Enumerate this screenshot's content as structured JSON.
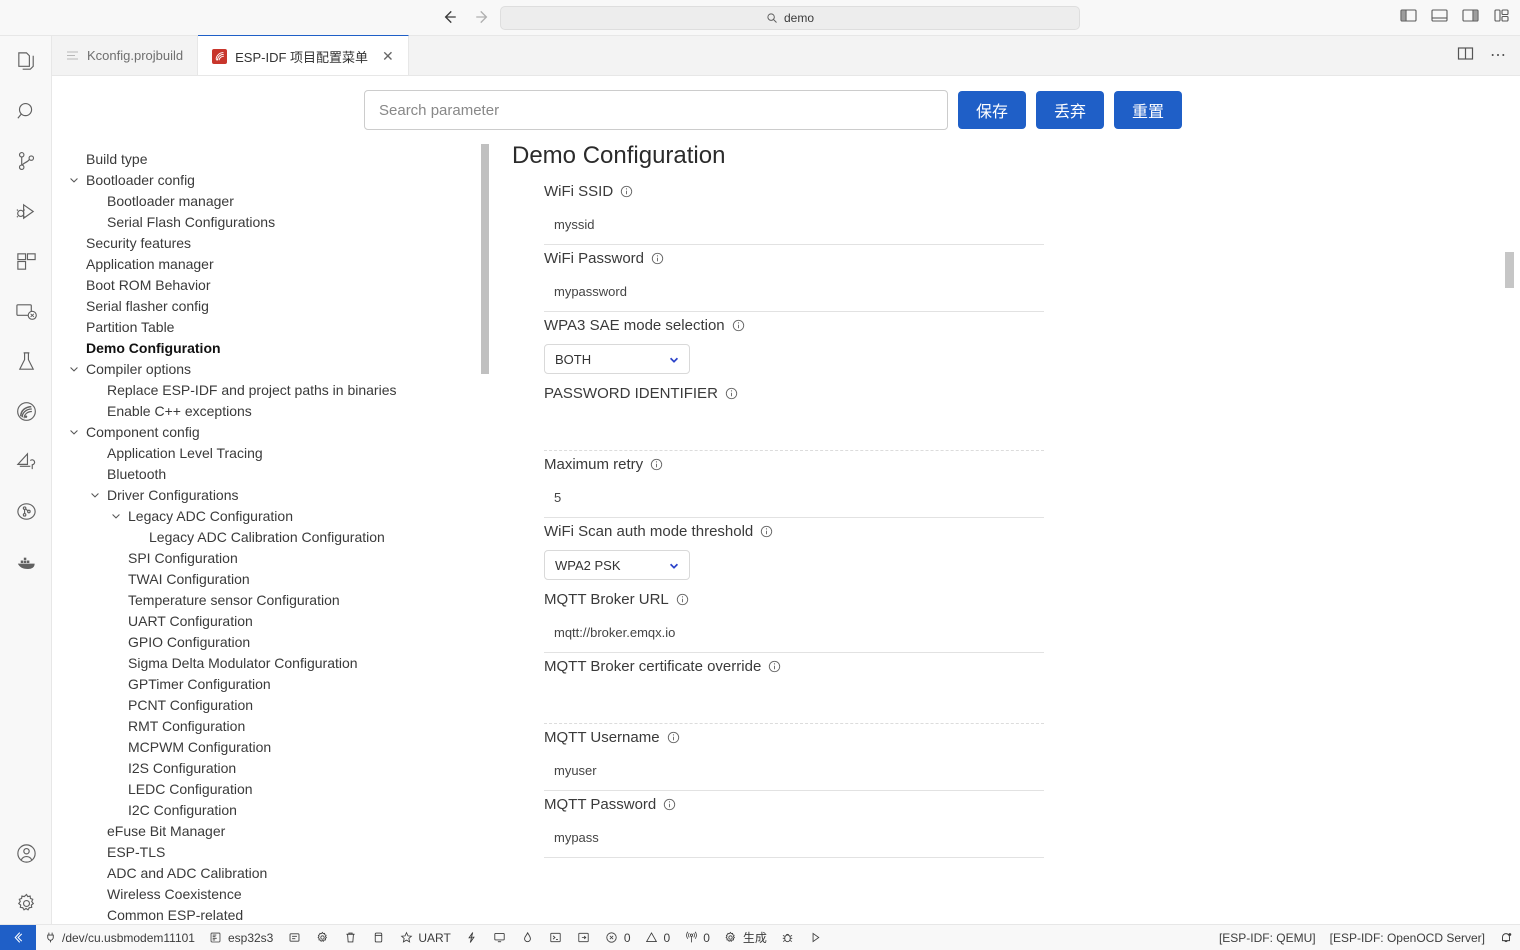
{
  "titlebar": {
    "back_icon": "arrow-left-icon",
    "forward_icon": "arrow-right-icon",
    "search_text": "demo",
    "search_icon": "search-icon",
    "layout_buttons": [
      {
        "name": "toggle-primary-sidebar",
        "icon": "layout-sidebar-left-icon"
      },
      {
        "name": "toggle-panel",
        "icon": "layout-panel-bottom-icon"
      },
      {
        "name": "toggle-secondary-sidebar",
        "icon": "layout-sidebar-right-icon"
      },
      {
        "name": "customize-layout",
        "icon": "layout-grid-icon"
      }
    ]
  },
  "activitybar": {
    "items": [
      {
        "name": "explorer",
        "icon": "files-icon"
      },
      {
        "name": "search",
        "icon": "search-icon"
      },
      {
        "name": "source-control",
        "icon": "source-control-icon"
      },
      {
        "name": "run-and-debug",
        "icon": "run-debug-icon"
      },
      {
        "name": "extensions",
        "icon": "extensions-icon"
      },
      {
        "name": "remote-explorer",
        "icon": "remote-explorer-icon"
      },
      {
        "name": "testing",
        "icon": "beaker-icon"
      },
      {
        "name": "espressif-idf",
        "icon": "espressif-logo-icon"
      },
      {
        "name": "esp-rainmaker",
        "icon": "rainmaker-icon"
      },
      {
        "name": "peripheral-view",
        "icon": "peripheral-icon"
      },
      {
        "name": "docker",
        "icon": "docker-icon"
      }
    ],
    "bottom_items": [
      {
        "name": "accounts",
        "icon": "account-icon"
      },
      {
        "name": "manage-settings",
        "icon": "gear-icon"
      }
    ]
  },
  "tabs": [
    {
      "label": "Kconfig.projbuild",
      "icon": "text-file-icon",
      "active": false,
      "closable": false
    },
    {
      "label": "ESP-IDF 项目配置菜单",
      "icon": "espressif-logo-icon",
      "active": true,
      "closable": true,
      "close_glyph": "✕"
    }
  ],
  "tabbar_actions": [
    {
      "name": "split-editor",
      "icon": "split-editor-icon"
    },
    {
      "name": "more-actions",
      "icon": "ellipsis-icon",
      "glyph": "⋯"
    }
  ],
  "toolbar": {
    "search_placeholder": "Search parameter",
    "search_value": "",
    "save_label": "保存",
    "discard_label": "丢弃",
    "reset_label": "重置",
    "button_color": "#1f5fc7"
  },
  "tree": {
    "items": [
      {
        "label": "Build type",
        "depth": 0,
        "chevron": "none",
        "selected": false
      },
      {
        "label": "Bootloader config",
        "depth": 0,
        "chevron": "down",
        "selected": false
      },
      {
        "label": "Bootloader manager",
        "depth": 1,
        "chevron": "none",
        "selected": false
      },
      {
        "label": "Serial Flash Configurations",
        "depth": 1,
        "chevron": "none",
        "selected": false
      },
      {
        "label": "Security features",
        "depth": 0,
        "chevron": "none",
        "selected": false
      },
      {
        "label": "Application manager",
        "depth": 0,
        "chevron": "none",
        "selected": false
      },
      {
        "label": "Boot ROM Behavior",
        "depth": 0,
        "chevron": "none",
        "selected": false
      },
      {
        "label": "Serial flasher config",
        "depth": 0,
        "chevron": "none",
        "selected": false
      },
      {
        "label": "Partition Table",
        "depth": 0,
        "chevron": "none",
        "selected": false
      },
      {
        "label": "Demo Configuration",
        "depth": 0,
        "chevron": "none",
        "selected": true
      },
      {
        "label": "Compiler options",
        "depth": 0,
        "chevron": "down",
        "selected": false
      },
      {
        "label": "Replace ESP-IDF and project paths in binaries",
        "depth": 1,
        "chevron": "none",
        "selected": false
      },
      {
        "label": "Enable C++ exceptions",
        "depth": 1,
        "chevron": "none",
        "selected": false
      },
      {
        "label": "Component config",
        "depth": 0,
        "chevron": "down",
        "selected": false
      },
      {
        "label": "Application Level Tracing",
        "depth": 1,
        "chevron": "none",
        "selected": false
      },
      {
        "label": "Bluetooth",
        "depth": 1,
        "chevron": "none",
        "selected": false
      },
      {
        "label": "Driver Configurations",
        "depth": 1,
        "chevron": "down",
        "selected": false
      },
      {
        "label": "Legacy ADC Configuration",
        "depth": 2,
        "chevron": "down",
        "selected": false
      },
      {
        "label": "Legacy ADC Calibration Configuration",
        "depth": 3,
        "chevron": "none",
        "selected": false
      },
      {
        "label": "SPI Configuration",
        "depth": 2,
        "chevron": "none",
        "selected": false
      },
      {
        "label": "TWAI Configuration",
        "depth": 2,
        "chevron": "none",
        "selected": false
      },
      {
        "label": "Temperature sensor Configuration",
        "depth": 2,
        "chevron": "none",
        "selected": false
      },
      {
        "label": "UART Configuration",
        "depth": 2,
        "chevron": "none",
        "selected": false
      },
      {
        "label": "GPIO Configuration",
        "depth": 2,
        "chevron": "none",
        "selected": false
      },
      {
        "label": "Sigma Delta Modulator Configuration",
        "depth": 2,
        "chevron": "none",
        "selected": false
      },
      {
        "label": "GPTimer Configuration",
        "depth": 2,
        "chevron": "none",
        "selected": false
      },
      {
        "label": "PCNT Configuration",
        "depth": 2,
        "chevron": "none",
        "selected": false
      },
      {
        "label": "RMT Configuration",
        "depth": 2,
        "chevron": "none",
        "selected": false
      },
      {
        "label": "MCPWM Configuration",
        "depth": 2,
        "chevron": "none",
        "selected": false
      },
      {
        "label": "I2S Configuration",
        "depth": 2,
        "chevron": "none",
        "selected": false
      },
      {
        "label": "LEDC Configuration",
        "depth": 2,
        "chevron": "none",
        "selected": false
      },
      {
        "label": "I2C Configuration",
        "depth": 2,
        "chevron": "none",
        "selected": false
      },
      {
        "label": "eFuse Bit Manager",
        "depth": 1,
        "chevron": "none",
        "selected": false
      },
      {
        "label": "ESP-TLS",
        "depth": 1,
        "chevron": "none",
        "selected": false
      },
      {
        "label": "ADC and ADC Calibration",
        "depth": 1,
        "chevron": "none",
        "selected": false
      },
      {
        "label": "Wireless Coexistence",
        "depth": 1,
        "chevron": "none",
        "selected": false
      },
      {
        "label": "Common ESP-related",
        "depth": 1,
        "chevron": "none",
        "selected": false
      }
    ]
  },
  "config": {
    "title": "Demo Configuration",
    "fields": [
      {
        "label": "WiFi SSID",
        "type": "text",
        "value": "myssid",
        "info_icon": "info-icon"
      },
      {
        "label": "WiFi Password",
        "type": "text",
        "value": "mypassword",
        "info_icon": "info-icon"
      },
      {
        "label": "WPA3 SAE mode selection",
        "type": "select",
        "value": "BOTH",
        "info_icon": "info-icon"
      },
      {
        "label": "PASSWORD IDENTIFIER",
        "type": "text",
        "value": "",
        "info_icon": "info-icon"
      },
      {
        "label": "Maximum retry",
        "type": "text",
        "value": "5",
        "info_icon": "info-icon"
      },
      {
        "label": "WiFi Scan auth mode threshold",
        "type": "select",
        "value": "WPA2 PSK",
        "info_icon": "info-icon"
      },
      {
        "label": "MQTT Broker URL",
        "type": "text",
        "value": "mqtt://broker.emqx.io",
        "info_icon": "info-icon"
      },
      {
        "label": "MQTT Broker certificate override",
        "type": "text",
        "value": "",
        "info_icon": "info-icon"
      },
      {
        "label": "MQTT Username",
        "type": "text",
        "value": "myuser",
        "info_icon": "info-icon"
      },
      {
        "label": "MQTT Password",
        "type": "text",
        "value": "mypass",
        "info_icon": "info-icon"
      }
    ]
  },
  "statusbar": {
    "remote_icon": "remote-window-icon",
    "items": [
      {
        "name": "serial-port",
        "icon": "plug-icon",
        "label": "/dev/cu.usbmodem11101"
      },
      {
        "name": "target-device",
        "icon": "chip-icon",
        "label": "esp32s3"
      },
      {
        "name": "select-flash-method",
        "icon": "folder-active-icon",
        "label": ""
      },
      {
        "name": "sdk-configuration-editor",
        "icon": "gear-icon",
        "label": ""
      },
      {
        "name": "full-clean",
        "icon": "trash-icon",
        "label": ""
      },
      {
        "name": "build-project",
        "icon": "database-icon",
        "label": ""
      },
      {
        "name": "monitor-device",
        "icon": "star-icon",
        "label": "UART"
      },
      {
        "name": "flash-device",
        "icon": "zap-icon",
        "label": ""
      },
      {
        "name": "open-monitor",
        "icon": "display-icon",
        "label": ""
      },
      {
        "name": "flame",
        "icon": "flame-icon",
        "label": ""
      },
      {
        "name": "terminal",
        "icon": "terminal-icon",
        "label": ""
      },
      {
        "name": "qemu-run",
        "icon": "debug-step-icon",
        "label": ""
      },
      {
        "name": "problems-errors",
        "icon": "error-icon",
        "label": "0"
      },
      {
        "name": "problems-warnings",
        "icon": "warning-icon",
        "label": "0"
      },
      {
        "name": "ports-forwarded",
        "icon": "radio-tower-icon",
        "label": "0"
      },
      {
        "name": "build-task",
        "icon": "gear-icon",
        "label": "生成"
      },
      {
        "name": "debug-task",
        "icon": "bug-icon",
        "label": ""
      },
      {
        "name": "run-task",
        "icon": "play-icon",
        "label": ""
      }
    ],
    "right_items": [
      {
        "name": "esp-idf-qemu",
        "label": "[ESP-IDF: QEMU]"
      },
      {
        "name": "esp-idf-openocd-server",
        "label": "[ESP-IDF: OpenOCD Server]"
      },
      {
        "name": "notifications",
        "icon": "bell-dot-icon",
        "label": ""
      }
    ]
  }
}
